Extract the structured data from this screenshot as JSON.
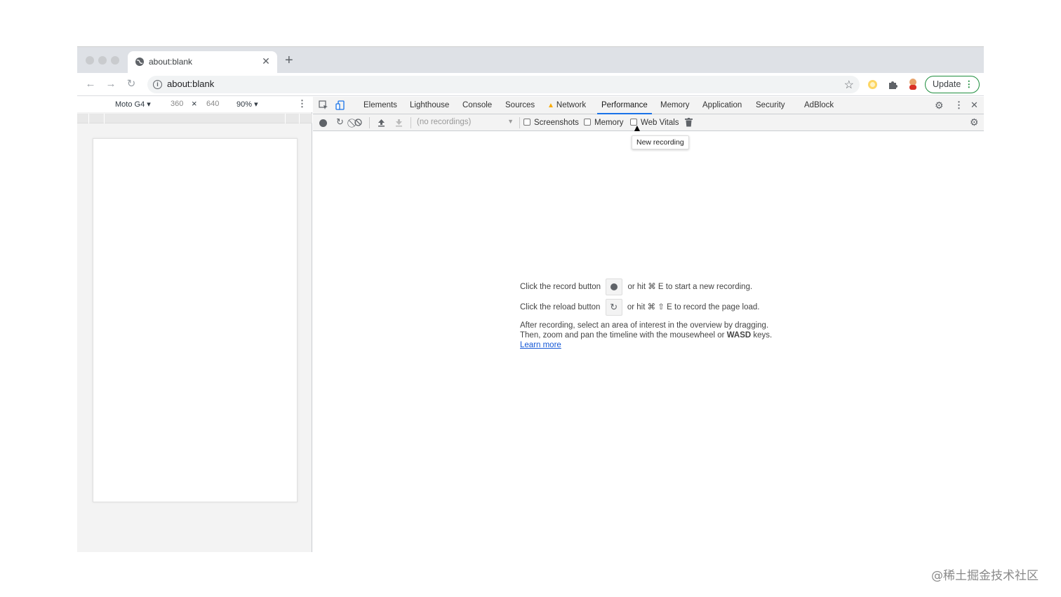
{
  "browser": {
    "tab_title": "about:blank",
    "new_tab_label": "+",
    "url": "about:blank",
    "update_label": "Update"
  },
  "device_toolbar": {
    "device": "Moto G4 ▾",
    "width": "360",
    "times": "×",
    "height": "640",
    "zoom": "90% ▾"
  },
  "devtools": {
    "tabs": [
      {
        "label": "Elements"
      },
      {
        "label": "Lighthouse"
      },
      {
        "label": "Console"
      },
      {
        "label": "Sources"
      },
      {
        "label": "Network"
      },
      {
        "label": "Performance"
      },
      {
        "label": "Memory"
      },
      {
        "label": "Application"
      },
      {
        "label": "Security"
      },
      {
        "label": "AdBlock"
      }
    ],
    "active_tab": "Performance",
    "toolbar": {
      "recordings_placeholder": "(no recordings)",
      "screenshots_label": "Screenshots",
      "memory_label": "Memory",
      "web_vitals_label": "Web Vitals"
    },
    "tooltip": "New recording",
    "landing": {
      "line1_a": "Click the record button",
      "line1_b": "or hit ⌘ E to start a new recording.",
      "line2_a": "Click the reload button",
      "line2_b": "or hit ⌘ ⇧ E to record the page load.",
      "line3": "After recording, select an area of interest in the overview by dragging.",
      "line4_a": "Then, zoom and pan the timeline with the mousewheel or",
      "line4_bold": "WASD",
      "line4_b": "keys.",
      "learn_more": "Learn more"
    }
  },
  "watermark": "@稀土掘金技术社区",
  "colors": {
    "accent": "#1a73e8",
    "update_border": "#1e8e3e",
    "warning": "#f9ab00"
  }
}
